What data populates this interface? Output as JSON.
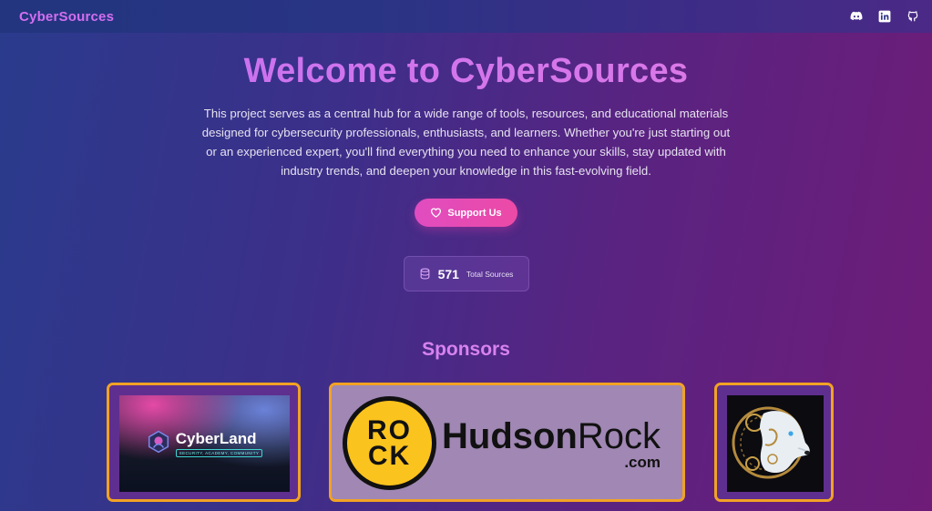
{
  "navbar": {
    "brand": "CyberSources",
    "icons": [
      "discord-icon",
      "linkedin-icon",
      "github-icon"
    ]
  },
  "hero": {
    "title": "Welcome to CyberSources",
    "description": "This project serves as a central hub for a wide range of tools, resources, and educational materials designed for cybersecurity professionals, enthusiasts, and learners. Whether you're just starting out or an experienced expert, you'll find everything you need to enhance your skills, stay updated with industry trends, and deepen your knowledge in this fast-evolving field.",
    "support_label": "Support Us",
    "stats": {
      "count": "571",
      "label": "Total Sources"
    }
  },
  "sponsors": {
    "title": "Sponsors",
    "items": [
      {
        "name": "CyberLand",
        "tagline": "SECURITY, ACADEMY, COMMUNITY"
      },
      {
        "name_bold": "Hudson",
        "name_light": "Rock",
        "domain": ".com",
        "badge_top": "RO",
        "badge_bottom": "CK"
      },
      {
        "name": "polar-bear-logo"
      }
    ]
  },
  "colors": {
    "brand": "#d36ef0",
    "accent_pink": "#e04cc0",
    "sponsor_border": "#f2a224"
  }
}
